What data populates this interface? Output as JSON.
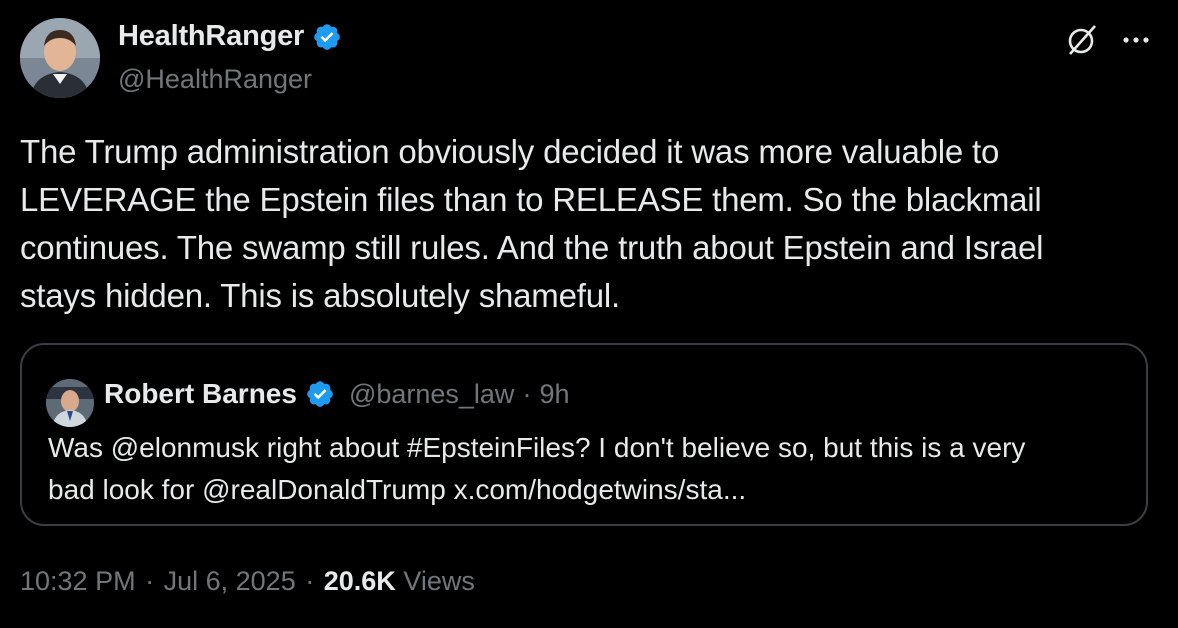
{
  "author": {
    "name": "HealthRanger",
    "handle": "@HealthRanger"
  },
  "tweet": {
    "lines": [
      "The Trump administration obviously decided it was more valuable to",
      "LEVERAGE the Epstein files than to RELEASE them. So the blackmail",
      "continues. The swamp still rules. And the truth about Epstein and Israel",
      "stays hidden. This is absolutely shameful."
    ]
  },
  "quote": {
    "name": "Robert Barnes",
    "handle": "@barnes_law",
    "separator": "·",
    "time": "9h",
    "lines": [
      "Was @elonmusk right about #EpsteinFiles? I don't believe so, but this is a very",
      "bad look for @realDonaldTrump x.com/hodgetwins/sta..."
    ]
  },
  "meta": {
    "time": "10:32 PM",
    "separator": "·",
    "date": "Jul 6, 2025",
    "views_count": "20.6K",
    "views_label": "Views"
  },
  "icons": {
    "verified": "verified-badge-icon",
    "grok": "grok-icon",
    "more": "more-horizontal-icon"
  },
  "colors": {
    "background": "#000000",
    "text": "#e7e9ea",
    "secondary": "#71767b",
    "verified": "#1d9bf0",
    "border": "#3a3e42"
  }
}
